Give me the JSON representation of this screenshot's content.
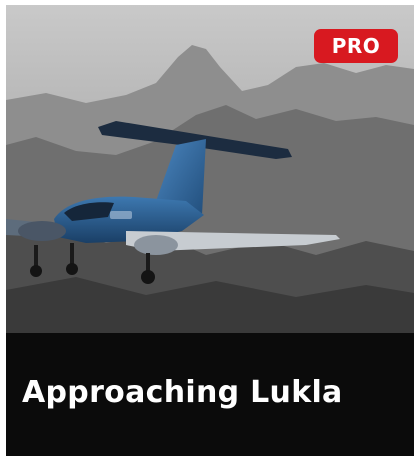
{
  "card": {
    "title": "Approaching Lukla",
    "badge": "PRO",
    "image_subject": "airplane-flying-past-mountains"
  },
  "colors": {
    "badge_background": "#d81920",
    "title_text": "#ffffff",
    "title_bar_background": "#0b0b0b",
    "aircraft_fuselage": "#2a5f93"
  }
}
